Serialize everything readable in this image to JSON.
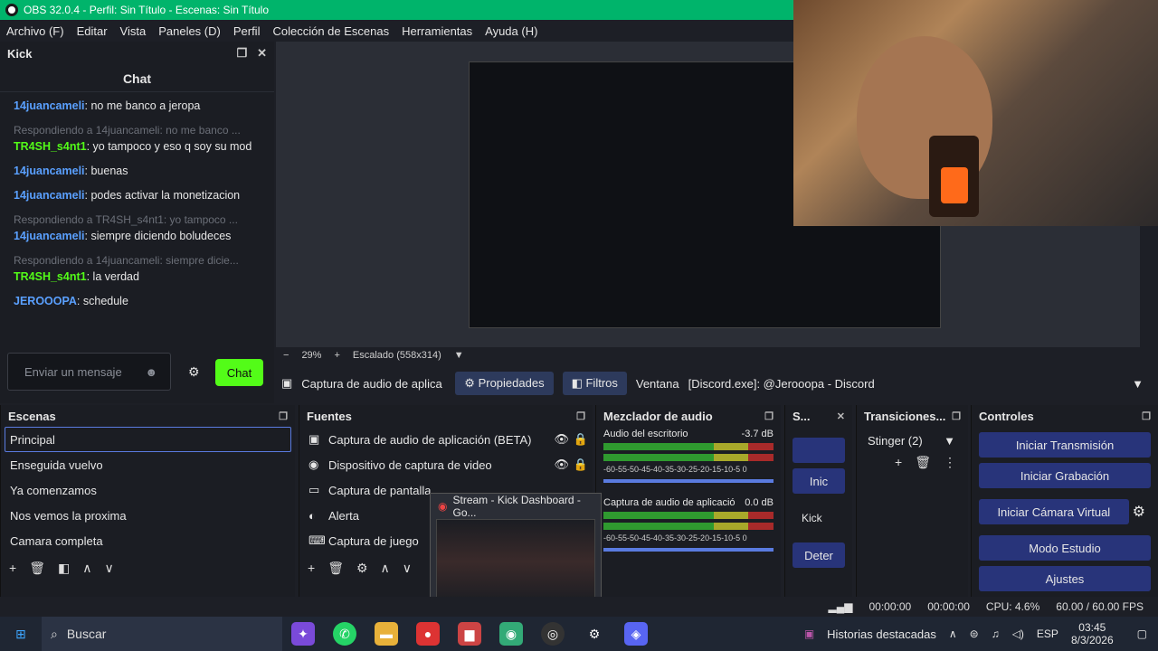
{
  "window": {
    "title": "OBS 32.0.4 - Perfil: Sin Título - Escenas: Sin Título"
  },
  "menu": [
    "Archivo (F)",
    "Editar",
    "Vista",
    "Paneles (D)",
    "Perfil",
    "Colección de Escenas",
    "Herramientas",
    "Ayuda (H)"
  ],
  "chat_dock": {
    "title": "Kick",
    "header": "Chat",
    "messages": [
      {
        "user": "14juancameli",
        "text": ": no me banco a jeropa",
        "color": "blue"
      },
      {
        "reply": "Respondiendo a 14juancameli: no me banco ...",
        "user": "TR4SH_s4nt1",
        "text": ": yo tampoco y eso q soy su mod",
        "color": "green"
      },
      {
        "user": "14juancameli",
        "text": ": buenas",
        "color": "blue"
      },
      {
        "user": "14juancameli",
        "text": ": podes activar la monetizacion",
        "color": "blue"
      },
      {
        "reply": "Respondiendo a TR4SH_s4nt1: yo tampoco ...",
        "user": "14juancameli",
        "text": ": siempre diciendo boludeces",
        "color": "blue"
      },
      {
        "reply": "Respondiendo a 14juancameli: siempre dicie...",
        "user": "TR4SH_s4nt1",
        "text": ": la verdad",
        "color": "green"
      },
      {
        "user": "JEROOOPA",
        "text": ": schedule",
        "color": "blue"
      }
    ],
    "input_placeholder": "Enviar un mensaje",
    "send_label": "Chat"
  },
  "zoom": {
    "level": "29%",
    "scale": "Escalado (558x314)"
  },
  "source_bar": {
    "source": "Captura de audio de aplica",
    "properties": "Propiedades",
    "filters": "Filtros",
    "window_label": "Ventana",
    "window_value": "[Discord.exe]: @Jerooopa - Discord"
  },
  "scenes": {
    "title": "Escenas",
    "items": [
      "Principal",
      "Enseguida vuelvo",
      "Ya comenzamos",
      "Nos vemos la proxima",
      "Camara completa"
    ]
  },
  "sources": {
    "title": "Fuentes",
    "items": [
      "Captura de audio de aplicación (BETA)",
      "Dispositivo de captura de video",
      "Captura de pantalla",
      "Alerta",
      "Captura de juego"
    ]
  },
  "mixer": {
    "title": "Mezclador de audio",
    "channels": [
      {
        "name": "Audio del escritorio",
        "db": "-3.7 dB"
      },
      {
        "name": "Captura de audio de aplicació",
        "db": "0.0 dB"
      }
    ],
    "scale": "-60-55-50-45-40-35-30-25-20-15-10-5 0"
  },
  "stats_dock": {
    "title": "S...",
    "items": [
      "Inic",
      "Kick",
      "Deter"
    ]
  },
  "transitions": {
    "title": "Transiciones...",
    "value": "Stinger (2)"
  },
  "controls": {
    "title": "Controles",
    "buttons": [
      "Iniciar Transmisión",
      "Iniciar Grabación",
      "Iniciar Cámara Virtual",
      "Modo Estudio",
      "Ajustes"
    ]
  },
  "status": {
    "time1": "00:00:00",
    "time2": "00:00:00",
    "cpu": "CPU: 4.6%",
    "fps": "60.00 / 60.00 FPS"
  },
  "popup": {
    "title": "Stream - Kick Dashboard - Go..."
  },
  "taskbar": {
    "search": "Buscar",
    "news": "Historias destacadas",
    "lang": "ESP",
    "time": "03:45",
    "date": "8/3/2026"
  }
}
